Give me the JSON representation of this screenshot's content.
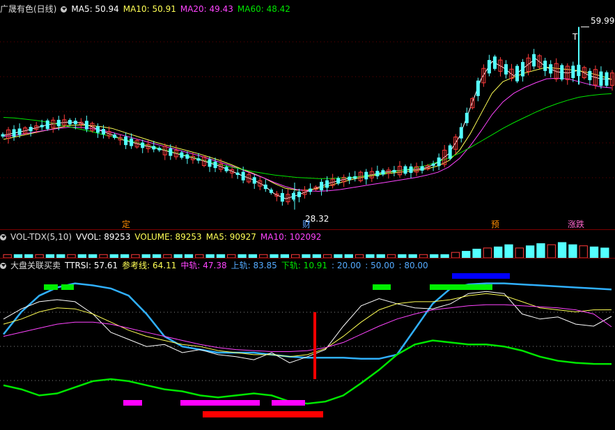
{
  "colors": {
    "cyan": "#54ffff",
    "red": "#ff3b3b",
    "white": "#ffffff",
    "yellow": "#ffff55",
    "magenta": "#ff44ff",
    "green": "#00e600",
    "gray": "#c8c8c8"
  },
  "price_panel": {
    "title": "广晟有色(日线)",
    "indicators": [
      {
        "label": "MA5: 50.94",
        "color": "#ffffff"
      },
      {
        "label": "MA10: 50.91",
        "color": "#ffff55"
      },
      {
        "label": "MA20: 49.43",
        "color": "#ff44ff"
      },
      {
        "label": "MA60: 48.42",
        "color": "#00e600"
      }
    ],
    "high_label": "59.99",
    "high_marker": "T",
    "low_label": "28.32",
    "event_labels": [
      {
        "text": "定",
        "color": "#ff8c00"
      },
      {
        "text": "财",
        "color": "#5aa0ff"
      },
      {
        "text": "预",
        "color": "#ff8c00"
      },
      {
        "text": "涨跌",
        "color": "#ff66cc"
      }
    ]
  },
  "volume_panel": {
    "title": "VOL-TDX(5,10)",
    "indicators": [
      {
        "label": "VVOL: 89253",
        "color": "#ffffff"
      },
      {
        "label": "VOLUME: 89253",
        "color": "#ffff55"
      },
      {
        "label": "MA5: 90927",
        "color": "#ffff55"
      },
      {
        "label": "MA10: 102092",
        "color": "#ff44ff"
      }
    ]
  },
  "indicator_panel": {
    "title": "大盘关联买卖",
    "indicators": [
      {
        "label": "TTRSI: 57.61",
        "color": "#ffffff"
      },
      {
        "label": "参考线: 64.11",
        "color": "#ffff55"
      },
      {
        "label": "中轨: 47.38",
        "color": "#ff44ff"
      },
      {
        "label": "上轨: 83.85",
        "color": "#54aaff"
      },
      {
        "label": "下轨: 10.91",
        "color": "#00e600"
      },
      {
        "label": ": 20.00",
        "color": "#54aaff"
      },
      {
        "label": ": 50.00",
        "color": "#54aaff"
      },
      {
        "label": ": 80.00",
        "color": "#54aaff"
      }
    ]
  },
  "chart_data": {
    "type": "candlestick",
    "y_range": [
      26,
      62
    ],
    "ma_lines": [
      {
        "name": "MA5",
        "color": "#ffffff",
        "values": [
          41.2,
          41.6,
          42.0,
          42.5,
          43.0,
          43.3,
          43.5,
          43.4,
          42.8,
          42.0,
          41.3,
          40.4,
          39.9,
          39.4,
          39.0,
          38.5,
          38.0,
          37.5,
          37.0,
          36.4,
          35.8,
          35.0,
          34.2,
          33.5,
          32.5,
          31.0,
          30.2,
          30.8,
          31.5,
          32.2,
          32.9,
          33.4,
          33.8,
          34.1,
          34.4,
          34.8,
          35.0,
          35.2,
          35.3,
          35.6,
          36.5,
          38.0,
          41.0,
          46.0,
          51.0,
          54.0,
          53.0,
          51.5,
          53.0,
          54.5,
          53.0,
          52.2,
          52.0,
          52.5,
          51.5,
          51.0,
          50.94
        ]
      },
      {
        "name": "MA10",
        "color": "#ffff55",
        "values": [
          40.5,
          40.9,
          41.3,
          41.7,
          42.1,
          42.5,
          42.9,
          43.0,
          42.9,
          42.7,
          42.4,
          41.8,
          41.2,
          40.6,
          40.0,
          39.5,
          39.0,
          38.5,
          38.0,
          37.4,
          36.8,
          36.1,
          35.3,
          34.6,
          33.8,
          32.8,
          32.0,
          31.7,
          31.7,
          32.0,
          32.5,
          33.0,
          33.5,
          33.9,
          34.2,
          34.5,
          34.7,
          34.9,
          35.1,
          35.4,
          35.9,
          36.8,
          38.6,
          41.5,
          45.0,
          48.5,
          50.5,
          51.3,
          52.0,
          52.5,
          53.0,
          52.8,
          52.6,
          52.4,
          52.0,
          51.5,
          50.91
        ]
      },
      {
        "name": "MA20",
        "color": "#ff44ff",
        "values": [
          41.0,
          41.2,
          41.5,
          41.8,
          42.1,
          42.4,
          42.6,
          42.6,
          42.4,
          42.1,
          41.7,
          41.2,
          40.7,
          40.2,
          39.7,
          39.2,
          38.7,
          38.2,
          37.7,
          37.1,
          36.5,
          35.9,
          35.2,
          34.5,
          33.8,
          33.0,
          32.3,
          31.8,
          31.6,
          31.5,
          31.6,
          31.8,
          32.1,
          32.4,
          32.7,
          33.0,
          33.3,
          33.6,
          33.9,
          34.3,
          34.8,
          35.7,
          37.2,
          39.4,
          42.0,
          44.8,
          47.0,
          48.5,
          49.5,
          50.3,
          51.0,
          51.1,
          51.0,
          50.5,
          50.0,
          49.6,
          49.43
        ]
      },
      {
        "name": "MA60",
        "color": "#00e600",
        "values": [
          44.3,
          44.2,
          44.0,
          43.8,
          43.5,
          43.1,
          42.7,
          42.3,
          41.9,
          41.4,
          41.0,
          40.5,
          40.1,
          39.6,
          39.1,
          38.6,
          38.1,
          37.6,
          37.1,
          36.6,
          36.1,
          35.7,
          35.3,
          34.9,
          34.6,
          34.3,
          34.1,
          33.9,
          33.8,
          33.7,
          33.7,
          33.8,
          33.9,
          34.1,
          34.3,
          34.6,
          34.9,
          35.2,
          35.6,
          36.0,
          36.6,
          37.3,
          38.1,
          39.1,
          40.2,
          41.3,
          42.4,
          43.4,
          44.3,
          45.2,
          46.0,
          46.7,
          47.3,
          47.8,
          48.1,
          48.3,
          48.42
        ]
      }
    ],
    "volume_values": [
      3,
      3,
      3,
      3,
      3,
      3,
      3,
      3,
      3,
      3,
      3,
      3,
      3,
      3,
      3,
      3,
      3,
      3,
      3,
      3,
      3,
      3,
      3,
      3,
      3,
      3,
      3,
      3,
      3,
      3,
      3,
      3,
      3,
      3,
      3,
      3,
      3,
      3,
      3,
      3,
      3,
      3,
      5,
      6,
      8,
      9,
      10,
      12,
      9,
      11,
      13,
      12,
      14,
      12,
      11,
      10,
      9
    ],
    "indicator_lines": [
      {
        "name": "上轨",
        "color": "#30b0ff",
        "values": [
          40,
          62,
          78,
          86,
          90,
          88,
          85,
          78,
          60,
          38,
          28,
          25,
          22,
          22,
          22,
          20,
          18,
          17,
          17,
          17,
          16,
          16,
          20,
          45,
          70,
          85,
          89,
          90,
          90,
          89,
          88,
          87,
          86,
          85,
          84
        ]
      },
      {
        "name": "TTRSI",
        "color": "#ffffff",
        "values": [
          55,
          65,
          72,
          74,
          72,
          60,
          42,
          35,
          28,
          30,
          22,
          25,
          20,
          18,
          15,
          22,
          12,
          18,
          25,
          48,
          68,
          75,
          70,
          66,
          65,
          70,
          80,
          82,
          80,
          60,
          55,
          57,
          50,
          48,
          57.61
        ]
      },
      {
        "name": "参考线",
        "color": "#ffff55",
        "values": [
          50,
          55,
          62,
          66,
          65,
          60,
          52,
          44,
          38,
          34,
          30,
          28,
          24,
          22,
          20,
          20,
          18,
          20,
          26,
          38,
          52,
          64,
          70,
          72,
          72,
          74,
          78,
          80,
          78,
          72,
          66,
          64,
          62,
          64,
          64.11
        ]
      },
      {
        "name": "中轨",
        "color": "#ff44ff",
        "values": [
          38,
          42,
          46,
          50,
          52,
          52,
          50,
          46,
          42,
          38,
          34,
          30,
          27,
          25,
          24,
          23,
          23,
          24,
          27,
          32,
          40,
          48,
          55,
          60,
          64,
          66,
          68,
          69,
          69,
          68,
          67,
          66,
          64,
          60,
          47.38
        ]
      },
      {
        "name": "下轨",
        "color": "#00e600",
        "values": [
          -10,
          -14,
          -20,
          -18,
          -12,
          -6,
          -4,
          -6,
          -10,
          -14,
          -16,
          -20,
          -22,
          -20,
          -18,
          -20,
          -26,
          -28,
          -26,
          -20,
          -8,
          5,
          20,
          30,
          34,
          32,
          30,
          30,
          28,
          24,
          18,
          14,
          12,
          11,
          10.91
        ]
      }
    ]
  }
}
